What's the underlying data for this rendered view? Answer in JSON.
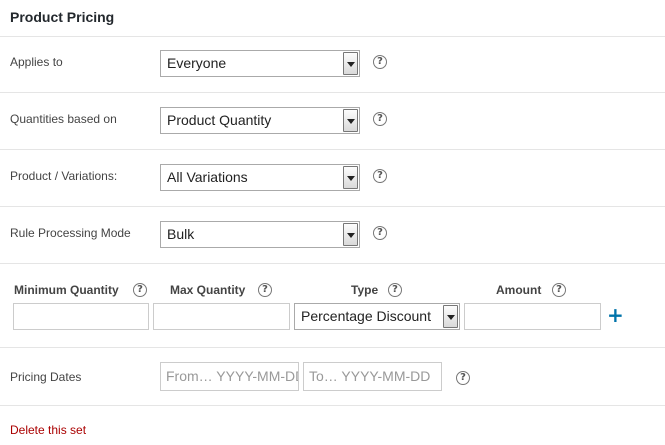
{
  "panel": {
    "title": "Product Pricing"
  },
  "rows": {
    "applies_to": {
      "label": "Applies to",
      "value": "Everyone"
    },
    "quantities_based_on": {
      "label": "Quantities based on",
      "value": "Product Quantity"
    },
    "product_variations": {
      "label": "Product / Variations:",
      "value": "All Variations"
    },
    "rule_processing_mode": {
      "label": "Rule Processing Mode",
      "value": "Bulk"
    }
  },
  "rule_table": {
    "columns": {
      "min_quantity": "Minimum Quantity",
      "max_quantity": "Max Quantity",
      "type": "Type",
      "amount": "Amount"
    },
    "row": {
      "min_quantity": "",
      "max_quantity": "",
      "type": "Percentage Discount",
      "amount": ""
    },
    "add_icon": "plus-icon"
  },
  "pricing_dates": {
    "label": "Pricing Dates",
    "from_placeholder": "From… YYYY-MM-DD",
    "to_placeholder": "To… YYYY-MM-DD"
  },
  "help_glyph": "?",
  "delete_link": "Delete this set",
  "colors": {
    "link_red": "#aa0000",
    "accent_blue": "#0073aa"
  }
}
